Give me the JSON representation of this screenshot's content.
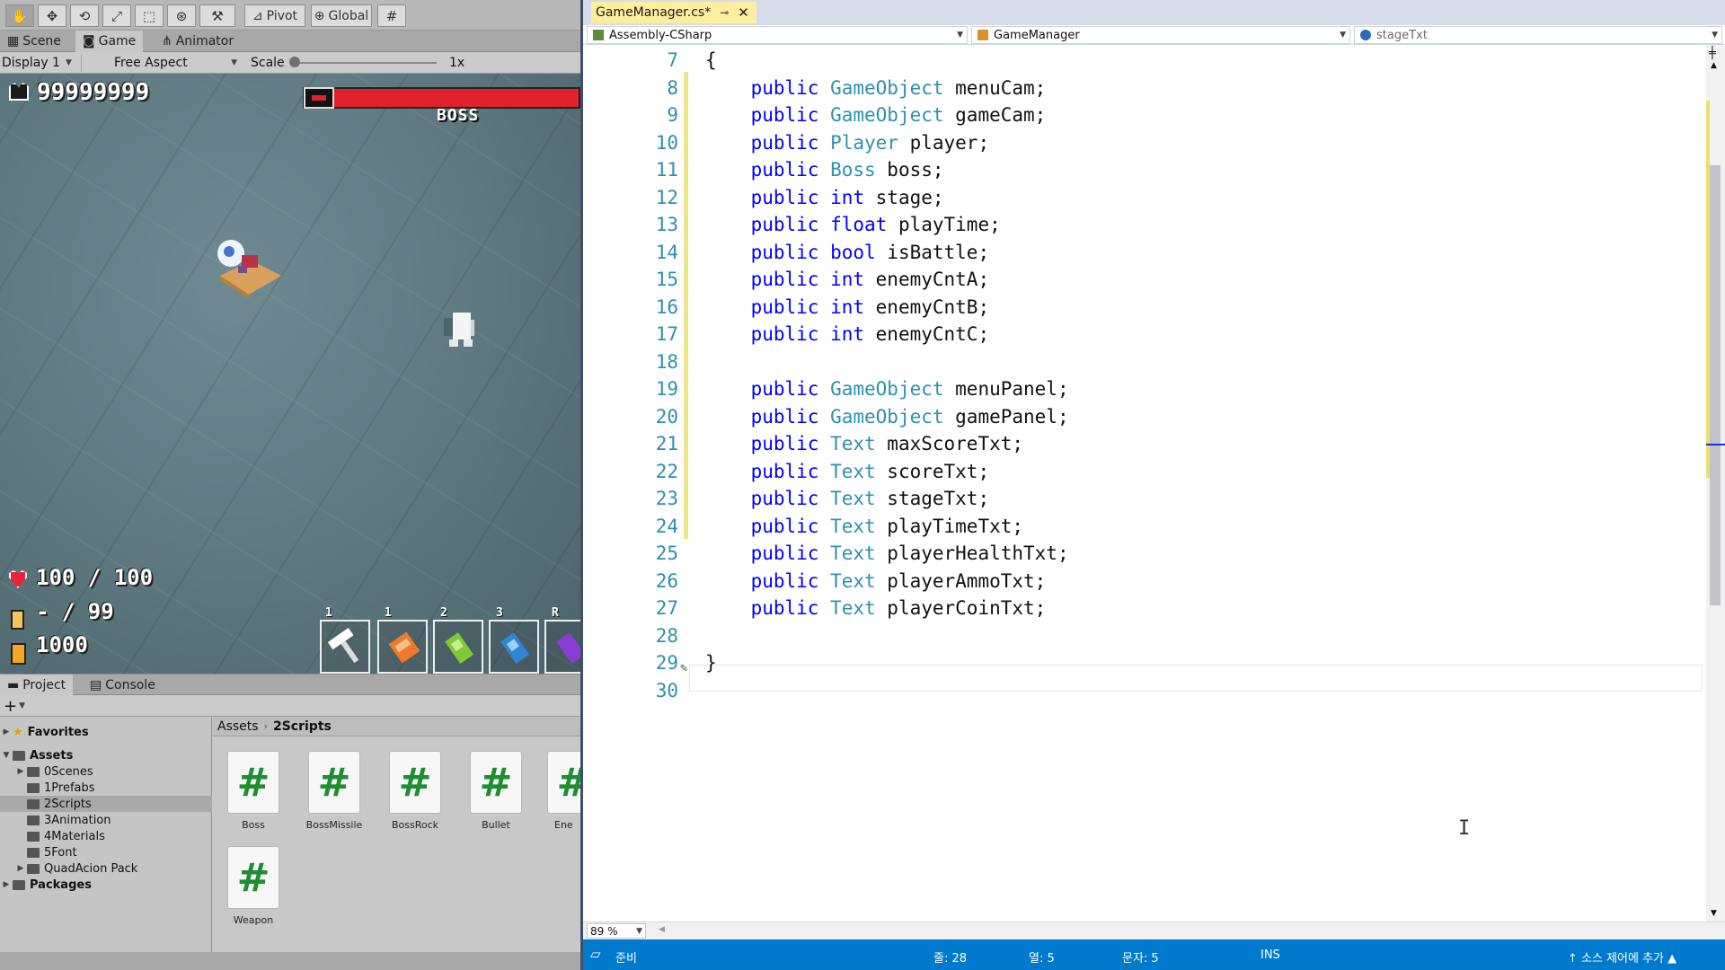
{
  "unity": {
    "toolbar": {
      "pivot": "Pivot",
      "global": "Global"
    },
    "view_tabs": {
      "scene": "Scene",
      "game": "Game",
      "animator": "Animator"
    },
    "game_bar": {
      "display": "Display 1",
      "aspect": "Free Aspect",
      "scale_label": "Scale",
      "scale_value": "1x"
    },
    "hud": {
      "score": "99999999",
      "boss_label": "BOSS",
      "health": "100 / 100",
      "ammo": "- / 99",
      "coins": "1000",
      "weapon_slots": [
        "1",
        "1",
        "2",
        "3",
        "R"
      ]
    },
    "project_tabs": {
      "project": "Project",
      "console": "Console"
    },
    "tree": {
      "favorites": "Favorites",
      "assets": "Assets",
      "folders": [
        "0Scenes",
        "1Prefabs",
        "2Scripts",
        "3Animation",
        "4Materials",
        "5Font",
        "QuadAcion Pack"
      ],
      "packages": "Packages"
    },
    "breadcrumb": {
      "root": "Assets",
      "current": "2Scripts"
    },
    "scripts": [
      "Boss",
      "BossMissile",
      "BossRock",
      "Bullet",
      "Ene",
      "Weapon"
    ]
  },
  "vs": {
    "tab_title": "GameManager.cs*",
    "nav": {
      "project": "Assembly-CSharp",
      "class": "GameManager",
      "member": "stageTxt"
    },
    "code_lines": [
      {
        "n": "7",
        "tokens": [
          {
            "t": "{",
            "c": "p"
          }
        ]
      },
      {
        "n": "8",
        "tokens": [
          {
            "t": "    public",
            "c": "kw"
          },
          {
            "t": " GameObject",
            "c": "ty"
          },
          {
            "t": " menuCam;",
            "c": "p"
          }
        ]
      },
      {
        "n": "9",
        "tokens": [
          {
            "t": "    public",
            "c": "kw"
          },
          {
            "t": " GameObject",
            "c": "ty"
          },
          {
            "t": " gameCam;",
            "c": "p"
          }
        ]
      },
      {
        "n": "10",
        "tokens": [
          {
            "t": "    public",
            "c": "kw"
          },
          {
            "t": " Player",
            "c": "ty"
          },
          {
            "t": " player;",
            "c": "p"
          }
        ]
      },
      {
        "n": "11",
        "tokens": [
          {
            "t": "    public",
            "c": "kw"
          },
          {
            "t": " Boss",
            "c": "ty"
          },
          {
            "t": " boss;",
            "c": "p"
          }
        ]
      },
      {
        "n": "12",
        "tokens": [
          {
            "t": "    public",
            "c": "kw"
          },
          {
            "t": " int",
            "c": "kw"
          },
          {
            "t": " stage;",
            "c": "p"
          }
        ]
      },
      {
        "n": "13",
        "tokens": [
          {
            "t": "    public",
            "c": "kw"
          },
          {
            "t": " float",
            "c": "kw"
          },
          {
            "t": " playTime;",
            "c": "p"
          }
        ]
      },
      {
        "n": "14",
        "tokens": [
          {
            "t": "    public",
            "c": "kw"
          },
          {
            "t": " bool",
            "c": "kw"
          },
          {
            "t": " isBattle;",
            "c": "p"
          }
        ]
      },
      {
        "n": "15",
        "tokens": [
          {
            "t": "    public",
            "c": "kw"
          },
          {
            "t": " int",
            "c": "kw"
          },
          {
            "t": " enemyCntA;",
            "c": "p"
          }
        ]
      },
      {
        "n": "16",
        "tokens": [
          {
            "t": "    public",
            "c": "kw"
          },
          {
            "t": " int",
            "c": "kw"
          },
          {
            "t": " enemyCntB;",
            "c": "p"
          }
        ]
      },
      {
        "n": "17",
        "tokens": [
          {
            "t": "    public",
            "c": "kw"
          },
          {
            "t": " int",
            "c": "kw"
          },
          {
            "t": " enemyCntC;",
            "c": "p"
          }
        ]
      },
      {
        "n": "18",
        "tokens": []
      },
      {
        "n": "19",
        "tokens": [
          {
            "t": "    public",
            "c": "kw"
          },
          {
            "t": " GameObject",
            "c": "ty"
          },
          {
            "t": " menuPanel;",
            "c": "p"
          }
        ]
      },
      {
        "n": "20",
        "tokens": [
          {
            "t": "    public",
            "c": "kw"
          },
          {
            "t": " GameObject",
            "c": "ty"
          },
          {
            "t": " gamePanel;",
            "c": "p"
          }
        ]
      },
      {
        "n": "21",
        "tokens": [
          {
            "t": "    public",
            "c": "kw"
          },
          {
            "t": " Text",
            "c": "ty"
          },
          {
            "t": " maxScoreTxt;",
            "c": "p"
          }
        ]
      },
      {
        "n": "22",
        "tokens": [
          {
            "t": "    public",
            "c": "kw"
          },
          {
            "t": " Text",
            "c": "ty"
          },
          {
            "t": " scoreTxt;",
            "c": "p"
          }
        ]
      },
      {
        "n": "23",
        "tokens": [
          {
            "t": "    public",
            "c": "kw"
          },
          {
            "t": " Text",
            "c": "ty"
          },
          {
            "t": " stageTxt;",
            "c": "p"
          }
        ]
      },
      {
        "n": "24",
        "tokens": [
          {
            "t": "    public",
            "c": "kw"
          },
          {
            "t": " Text",
            "c": "ty"
          },
          {
            "t": " playTimeTxt;",
            "c": "p"
          }
        ]
      },
      {
        "n": "25",
        "tokens": [
          {
            "t": "    public",
            "c": "kw"
          },
          {
            "t": " Text",
            "c": "ty"
          },
          {
            "t": " playerHealthTxt;",
            "c": "p"
          }
        ]
      },
      {
        "n": "26",
        "tokens": [
          {
            "t": "    public",
            "c": "kw"
          },
          {
            "t": " Text",
            "c": "ty"
          },
          {
            "t": " playerAmmoTxt;",
            "c": "p"
          }
        ]
      },
      {
        "n": "27",
        "tokens": [
          {
            "t": "    public",
            "c": "kw"
          },
          {
            "t": " Text",
            "c": "ty"
          },
          {
            "t": " playerCoinTxt;",
            "c": "p"
          }
        ]
      },
      {
        "n": "28",
        "tokens": []
      },
      {
        "n": "29",
        "tokens": [
          {
            "t": "}",
            "c": "p"
          }
        ]
      },
      {
        "n": "30",
        "tokens": []
      }
    ],
    "zoom": "89 %",
    "status": {
      "ready": "준비",
      "line": "줄: 28",
      "col": "열: 5",
      "ch": "문자: 5",
      "ins": "INS",
      "source_control": "소스 제어에 추가"
    }
  },
  "colors": {
    "keyword": "#0000ff",
    "type": "#2b91af",
    "status_bar": "#007acc",
    "tab_active": "#ffee9e",
    "boss_health": "#e0222d"
  }
}
